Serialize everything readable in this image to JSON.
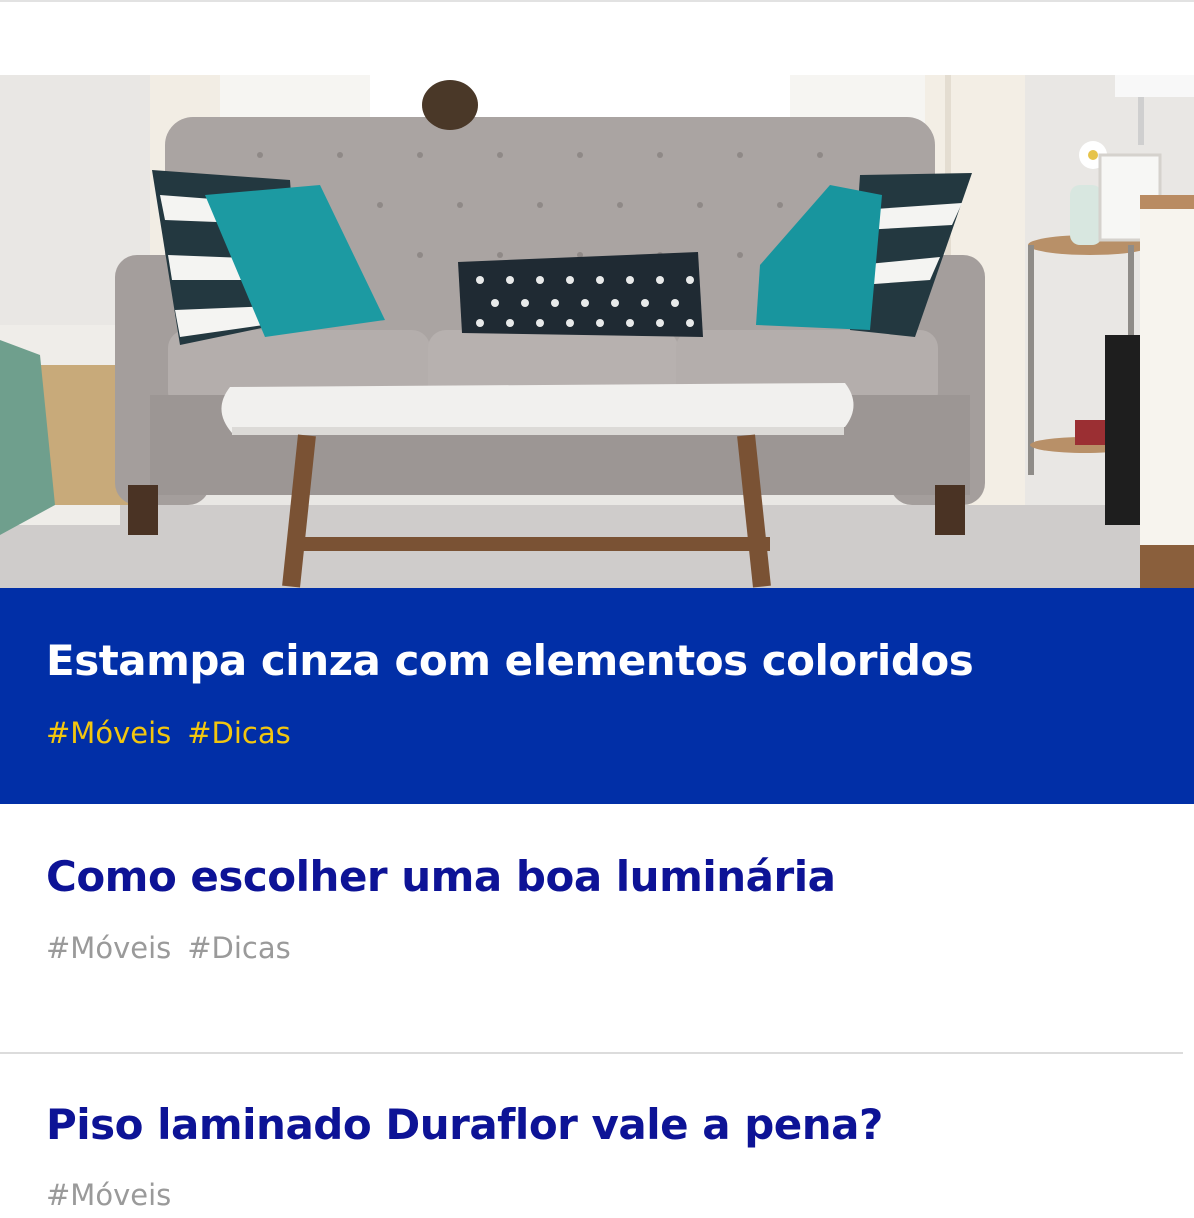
{
  "featured": {
    "image_alt": "Sofá cinza com almofadas coloridas em uma sala de estar",
    "title": "Estampa cinza com elementos coloridos",
    "tags": [
      "#Móveis",
      "#Dicas"
    ],
    "colors": {
      "background": "#012fa7",
      "title": "#ffffff",
      "tags": "#f2c60f"
    }
  },
  "posts": [
    {
      "title": "Como escolher uma boa luminária",
      "tags": [
        "#Móveis",
        "#Dicas"
      ]
    },
    {
      "title": "Piso laminado Duraflor vale a pena?",
      "tags": [
        "#Móveis"
      ]
    }
  ],
  "colors": {
    "post_title": "#0d1396",
    "post_tags": "#9a9a9a",
    "divider": "#dcdcdc"
  }
}
